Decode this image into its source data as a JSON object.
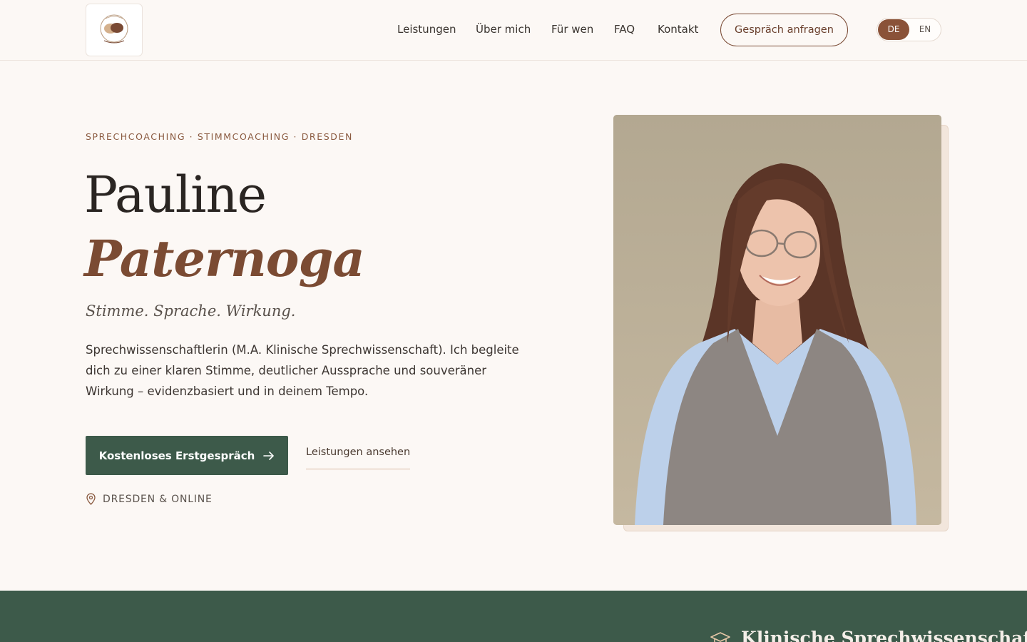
{
  "header": {
    "logo_alt": "Pauline Paternoga",
    "nav": [
      "Leistungen",
      "Über mich",
      "Für wen",
      "FAQ",
      "Kontakt"
    ],
    "cta_label": "Gespräch anfragen",
    "lang": {
      "active": "DE",
      "inactive": "EN"
    }
  },
  "hero": {
    "eyebrow": "SPRECHCOACHING · STIMMCOACHING · DRESDEN",
    "first_name": "Pauline",
    "last_name": "Paternoga",
    "tagline": "Stimme. Sprache. Wirkung.",
    "intro": "Sprechwissenschaftlerin (M.A. Klinische Sprechwissenschaft). Ich begleite dich zu einer klaren Stimme, deutlicher Aussprache und souveräner Wirkung – evidenzbasiert und in deinem Tempo.",
    "primary_cta": "Kostenloses Erstgespräch",
    "secondary_cta": "Leistungen ansehen",
    "location": "DRESDEN & ONLINE"
  },
  "band": {
    "title": "Klinische Sprechwissenschaft"
  },
  "colors": {
    "accent_brown": "#7b4b33",
    "accent_green": "#3d5a4a",
    "background": "#fcf8f5"
  },
  "icons": {
    "arrow": "arrow-right-icon",
    "location": "map-pin-icon",
    "band": "graduation-cap-icon"
  }
}
